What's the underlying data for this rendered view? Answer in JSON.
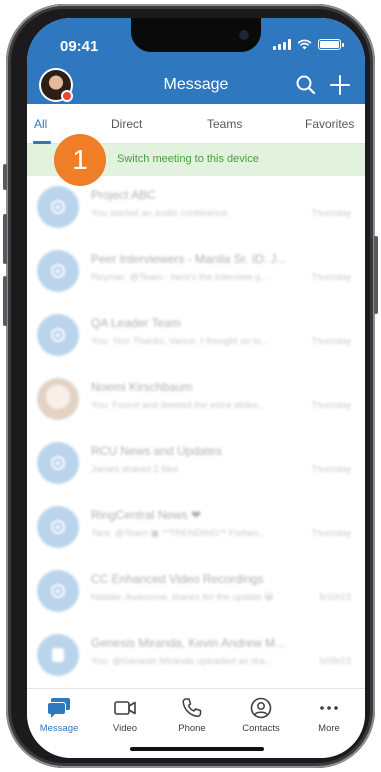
{
  "status_bar": {
    "time": "09:41"
  },
  "header": {
    "title": "Message"
  },
  "tabs": [
    {
      "label": "All",
      "active": true
    },
    {
      "label": "Direct",
      "active": false
    },
    {
      "label": "Teams",
      "active": false
    },
    {
      "label": "Favorites",
      "active": false
    }
  ],
  "banner": {
    "text": "Switch meeting to this device",
    "step_number": "1"
  },
  "conversations": [
    {
      "title": "Project ABC",
      "preview": "You started an audio conference.",
      "time": "Thursday",
      "avatar": "team"
    },
    {
      "title": "Peer Interviewers - Manila Sr. ID: J...",
      "preview": "Reymar: @Team - here's the interview g...",
      "time": "Thursday",
      "avatar": "team"
    },
    {
      "title": "QA Leader Team",
      "preview": "You: Yes! Thanks, Vance. I thought so to...",
      "time": "Thursday",
      "avatar": "team"
    },
    {
      "title": "Noemi Kirschbaum",
      "preview": "You: Found and deleted the extra slides...",
      "time": "Thursday",
      "avatar": "photo"
    },
    {
      "title": "RCU News and Updates",
      "preview": "James shared 2 files",
      "time": "Thursday",
      "avatar": "team"
    },
    {
      "title": "RingCentral News ❤",
      "preview": "Tara: @Team ▣ **TRENDING** Forbes...",
      "time": "Thursday",
      "avatar": "team"
    },
    {
      "title": "CC Enhanced Video Recordings",
      "preview": "Natalie: Awesome, thanks for the update 😀",
      "time": "5/10/23",
      "avatar": "team"
    },
    {
      "title": "Genesis Miranda, Kevin Andrew M...",
      "preview": "You: @Genesis Miranda uploaded as dra...",
      "time": "5/09/23",
      "avatar": "group"
    }
  ],
  "bottom_nav": [
    {
      "label": "Message",
      "active": true
    },
    {
      "label": "Video",
      "active": false
    },
    {
      "label": "Phone",
      "active": false
    },
    {
      "label": "Contacts",
      "active": false
    },
    {
      "label": "More",
      "active": false
    }
  ],
  "colors": {
    "brand_blue": "#2f78bf",
    "banner_bg": "#e3f1df",
    "banner_text": "#4a9d3d",
    "step_badge": "#f07e26",
    "presence_dot": "#e8443a"
  }
}
